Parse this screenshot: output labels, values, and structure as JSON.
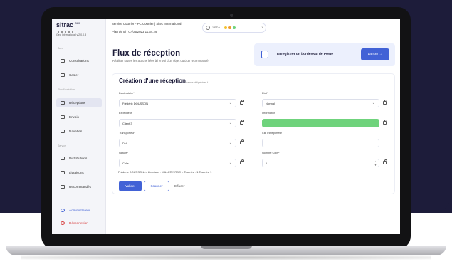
{
  "app": {
    "logo": "sitrac",
    "logo_sup": "360",
    "version": "Geo International v.2.0.0.8"
  },
  "sidebar": {
    "section_main": "Suivi",
    "section_flux": "Flux & création",
    "section_service": "Service",
    "items": [
      {
        "label": "Consultations"
      },
      {
        "label": "Casier"
      },
      {
        "label": "Réceptions"
      },
      {
        "label": "Envois"
      },
      {
        "label": "Navettes"
      },
      {
        "label": "Distributions"
      },
      {
        "label": "Livraisons"
      },
      {
        "label": "Recommandés"
      }
    ],
    "admin": "Administrateur",
    "logout": "Déconnexion"
  },
  "topbar": {
    "service": "Service Courrier - PC Courrier | Sitec International",
    "plan": "Plan de tri : 07/06/2023 11:34:29",
    "status_label": "1 PDA"
  },
  "page": {
    "title": "Flux de réception",
    "subtitle": "Réaliser toutes les actions liées à l'envoi d'un objet ou d'un recommandé"
  },
  "cta": {
    "text": "Enregistrer un bordereau de Poste",
    "button": "Lancer →"
  },
  "form": {
    "title": "Création d'une réception",
    "hint": "Champs obligatoires *",
    "destinataire": {
      "label": "Destinataire*",
      "value": "Frédéric DOUSSON"
    },
    "expediteur": {
      "label": "Expéditeur",
      "value": "Client 3"
    },
    "transporteur": {
      "label": "Transporteur*",
      "value": "DHL"
    },
    "nature": {
      "label": "Nature*",
      "value": "Colis"
    },
    "etat": {
      "label": "Etat*",
      "value": "Normal"
    },
    "information": {
      "label": "Information",
      "value": ""
    },
    "cb_transporteur": {
      "label": "CB Transporteur",
      "value": ""
    },
    "nombre_colis": {
      "label": "Nombre Colis*",
      "value": "1"
    },
    "info_line": "Frédéric DOUSSON -> Livraison : MILLERY RDC > Tournée : 1 Tournée 1",
    "validate": "Valider",
    "scan": "Scanner",
    "clear": "Effacer"
  },
  "colors": {
    "primary": "#4262d6",
    "dark": "#1d1c3a",
    "green": "#6fd37c"
  }
}
